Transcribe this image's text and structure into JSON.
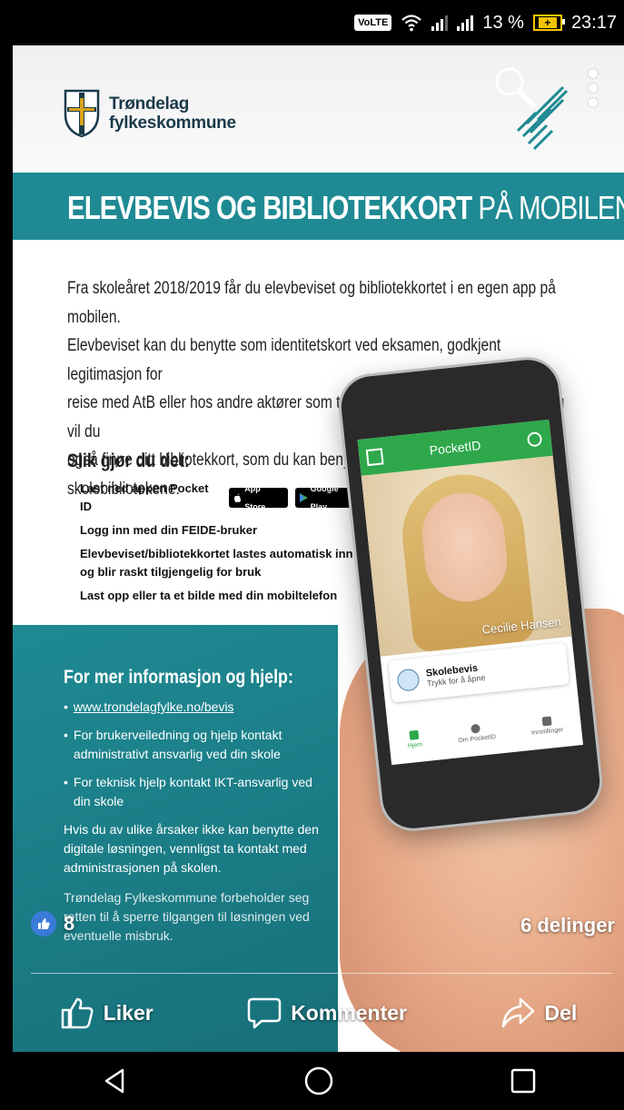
{
  "status_bar": {
    "volte": "VoLTE",
    "battery_percent": "13 %",
    "time": "23:17",
    "battery_charging": "+"
  },
  "poster": {
    "org_name_line1": "Trøndelag",
    "org_name_line2": "fylkeskommune",
    "banner_bold": "ELEVBEVIS OG BIBLIOTEKKORT",
    "banner_light": " PÅ MOBILEN",
    "intro_lines": [
      "Fra skoleåret 2018/2019 får du elevbeviset og bibliotekkortet i en egen app på mobilen.",
      "Elevbeviset kan du benytte som identitetskort ved eksamen, godkjent legitimasjon for",
      "reise med AtB eller hos andre aktører som tilbyr studentrabatt. I samme løsning vil du",
      "også finne ditt bibliotekkort, som du kan benytte på",
      "skolebibliotekene."
    ],
    "steps_title": "Slik gjør du det:",
    "steps": [
      "Last ned appen Pocket ID",
      "Logg inn med din FEIDE-bruker",
      "Elevbeviset/bibliotekkortet lastes automatisk inn og blir raskt tilgjengelig for bruk",
      "Last opp eller ta et bilde med din mobiltelefon"
    ],
    "app_store_badge": "App Store",
    "google_play_badge": "Google Play",
    "info_title": "For mer informasjon og hjelp:",
    "info_items": [
      "www.trondelagfylke.no/bevis",
      "For brukerveiledning og hjelp kontakt administrativt ansvarlig ved din skole",
      "For teknisk hjelp kontakt IKT-ansvarlig ved din skole"
    ],
    "info_paragraph1": "Hvis du av ulike årsaker ikke kan benytte den digitale løsningen, vennligst ta kontakt med administrasjonen på skolen.",
    "info_paragraph2": "Trøndelag Fylkeskommune forbeholder seg retten til å sperre tilgangen til løsningen ved eventuelle misbruk.",
    "mock_app": {
      "title": "PocketID",
      "person_name": "Cecilie Hansen",
      "card_title": "Skolebevis",
      "card_subtitle": "Trykk for å åpne",
      "tabs": [
        "Hjem",
        "Om PocketID",
        "Innstillinger"
      ]
    }
  },
  "facebook": {
    "like_count": "8",
    "shares": "6 delinger",
    "like_label": "Liker",
    "comment_label": "Kommenter",
    "share_label": "Del"
  },
  "colors": {
    "teal": "#1f8a93",
    "app_green": "#2ea84a",
    "fb_blue": "#3b7bd8"
  }
}
